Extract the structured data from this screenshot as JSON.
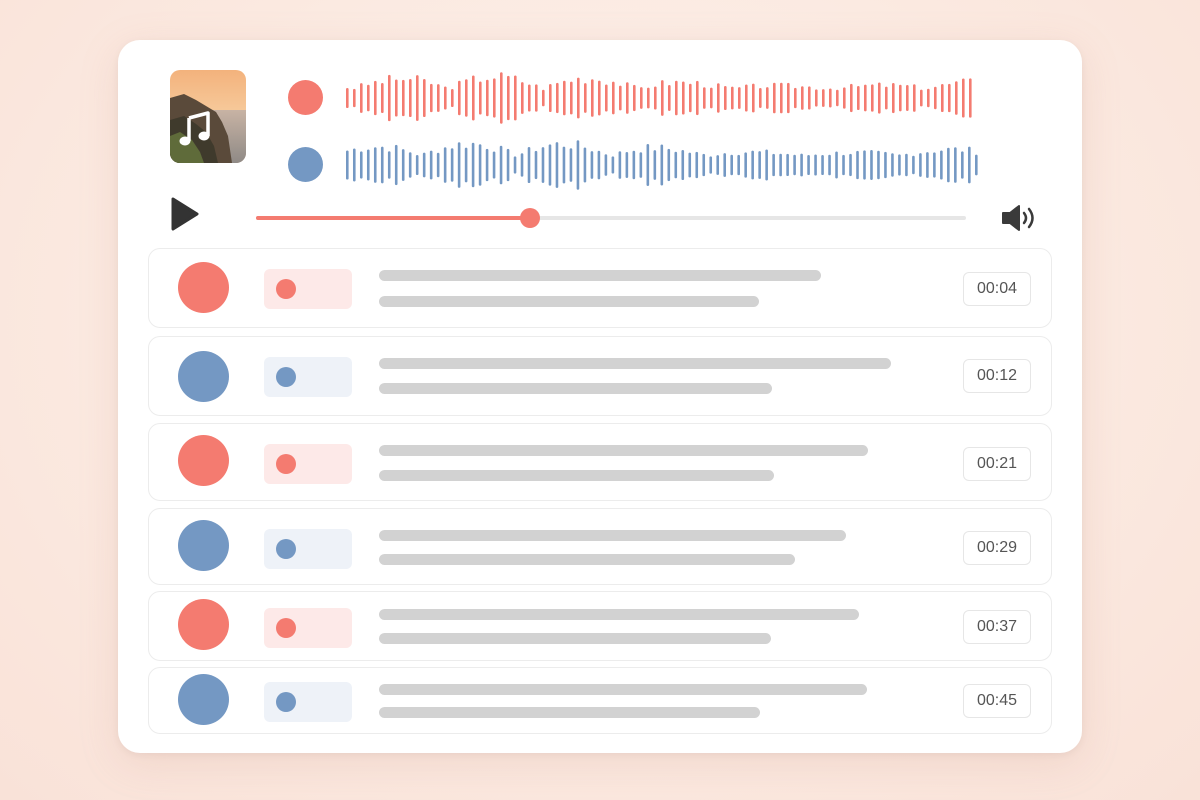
{
  "colors": {
    "speaker_a": "#f47b70",
    "speaker_a_light": "#fde9e8",
    "speaker_b": "#7498c3",
    "speaker_b_light": "#eef2f8",
    "skeleton": "#d2d2d2",
    "play": "#333333"
  },
  "player": {
    "cover_icon": "music-note-icon",
    "play_icon": "play-icon",
    "volume_icon": "volume-icon",
    "progress": 0.386
  },
  "tracks": [
    {
      "speaker": "a",
      "icon": "speaker-dot"
    },
    {
      "speaker": "b",
      "icon": "speaker-dot"
    }
  ],
  "segments": [
    {
      "speaker": "a",
      "time": "00:04"
    },
    {
      "speaker": "b",
      "time": "00:12"
    },
    {
      "speaker": "a",
      "time": "00:21"
    },
    {
      "speaker": "b",
      "time": "00:29"
    },
    {
      "speaker": "a",
      "time": "00:37"
    },
    {
      "speaker": "b",
      "time": "00:45"
    }
  ]
}
